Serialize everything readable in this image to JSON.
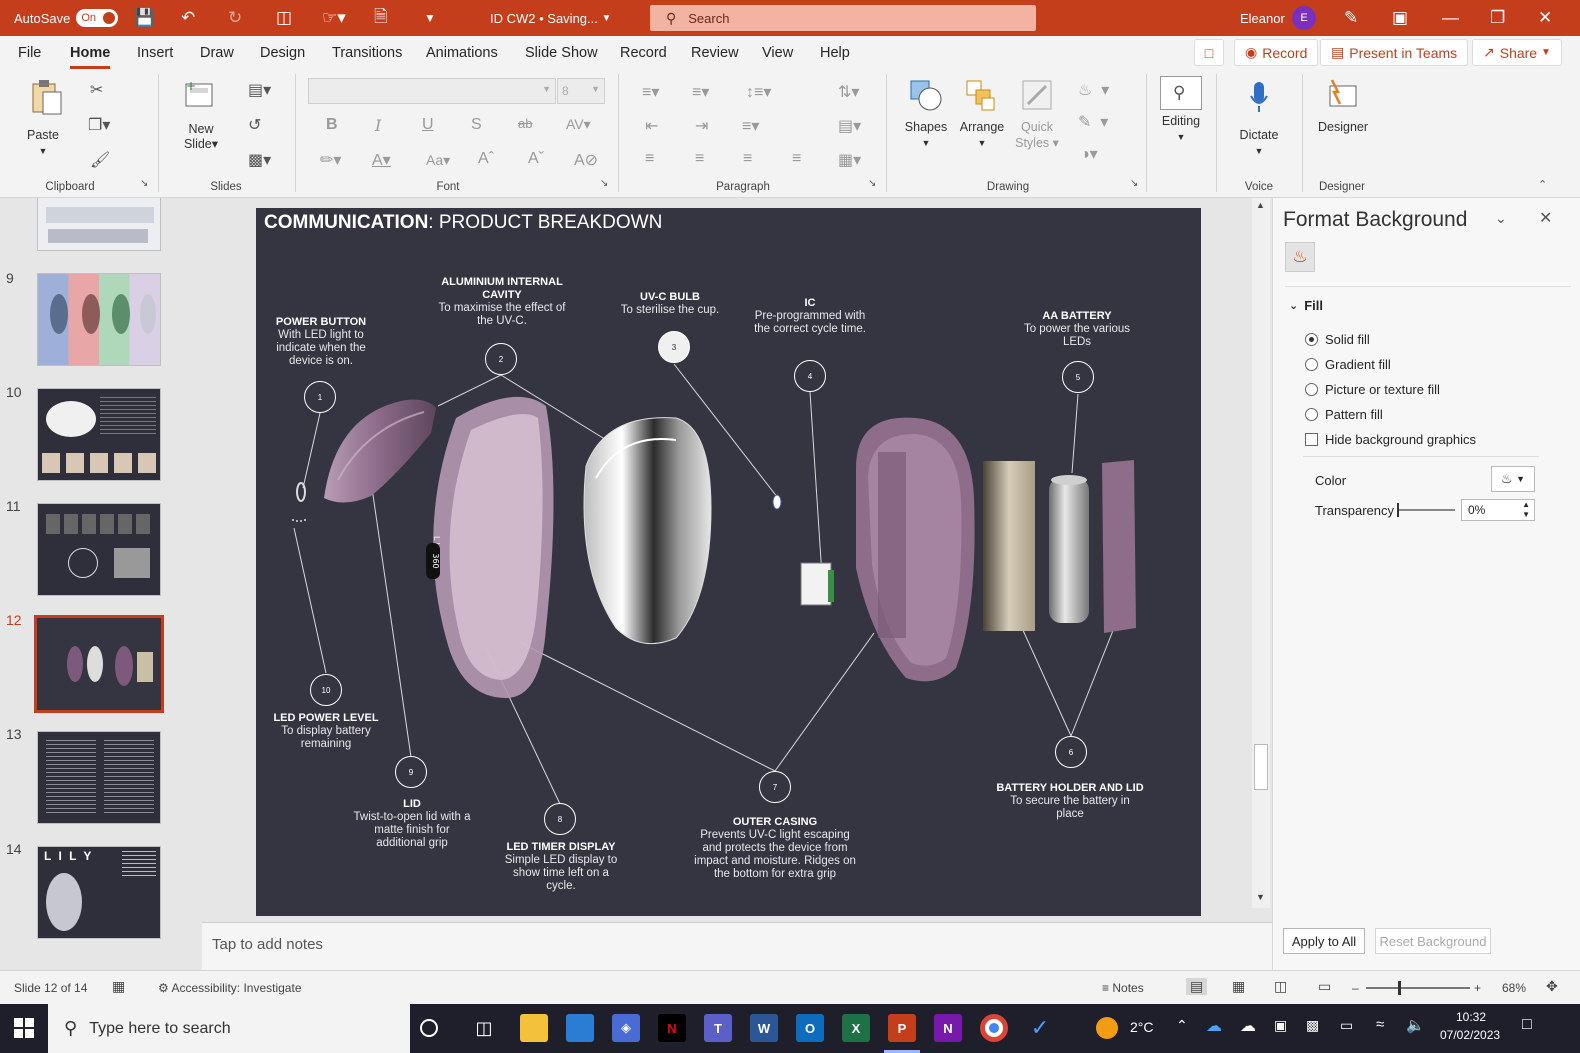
{
  "titlebar": {
    "autosave_label": "AutoSave",
    "autosave_state": "On",
    "doc_title": "ID CW2 • Saving...",
    "search_placeholder": "Search",
    "user_name": "Eleanor",
    "user_initial": "E"
  },
  "tabs": [
    "File",
    "Home",
    "Insert",
    "Draw",
    "Design",
    "Transitions",
    "Animations",
    "Slide Show",
    "Record",
    "Review",
    "View",
    "Help"
  ],
  "active_tab": "Home",
  "ribbon_actions": {
    "record": "Record",
    "present_in_teams": "Present in Teams",
    "share": "Share"
  },
  "ribbon": {
    "paste": "Paste",
    "new_slide_1": "New",
    "new_slide_2": "Slide",
    "font_size": "8",
    "shapes": "Shapes",
    "arrange": "Arrange",
    "quick_styles_1": "Quick",
    "quick_styles_2": "Styles",
    "editing": "Editing",
    "dictate": "Dictate",
    "designer": "Designer",
    "groups": {
      "clipboard": "Clipboard",
      "slides": "Slides",
      "font": "Font",
      "paragraph": "Paragraph",
      "drawing": "Drawing",
      "voice": "Voice",
      "designer": "Designer"
    }
  },
  "thumbnails": {
    "numbers": [
      "9",
      "10",
      "11",
      "12",
      "13",
      "14"
    ],
    "selected": "12",
    "slide14_title": "L I L Y"
  },
  "slide": {
    "title_bold": "COMMUNICATION",
    "title_rest": ": PRODUCT BREAKDOWN",
    "product_name": "LILY",
    "timer_display": "360",
    "labels": [
      {
        "num": "1",
        "title": "POWER BUTTON",
        "desc": "With LED light to indicate when the device is on."
      },
      {
        "num": "2",
        "title": "ALUMINIUM INTERNAL CAVITY",
        "desc": "To maximise the effect of the UV-C."
      },
      {
        "num": "3",
        "title": "UV-C BULB",
        "desc": "To sterilise the cup."
      },
      {
        "num": "4",
        "title": "IC",
        "desc": "Pre-programmed with the correct cycle time."
      },
      {
        "num": "5",
        "title": "AA BATTERY",
        "desc": "To power the various LEDs"
      },
      {
        "num": "6",
        "title": "BATTERY HOLDER AND LID",
        "desc": "To secure the battery in place"
      },
      {
        "num": "7",
        "title": "OUTER CASING",
        "desc": "Prevents UV-C light escaping and protects the device from impact and moisture. Ridges on the bottom for extra grip"
      },
      {
        "num": "8",
        "title": "LED TIMER DISPLAY",
        "desc": "Simple LED display to show time left on a cycle."
      },
      {
        "num": "9",
        "title": "LID",
        "desc": "Twist-to-open lid with a matte finish for additional grip"
      },
      {
        "num": "10",
        "title": "LED POWER LEVEL",
        "desc": "To display battery remaining"
      }
    ]
  },
  "notes_placeholder": "Tap to add notes",
  "format_pane": {
    "title": "Format Background",
    "section": "Fill",
    "options": [
      "Solid fill",
      "Gradient fill",
      "Picture or texture fill",
      "Pattern fill"
    ],
    "selected_option": "Solid fill",
    "hide_graphics": "Hide background graphics",
    "color_label": "Color",
    "transparency_label": "Transparency",
    "transparency_value": "0%",
    "apply_all": "Apply to All",
    "reset": "Reset Background"
  },
  "statusbar": {
    "slide_info": "Slide 12 of 14",
    "accessibility": "Accessibility: Investigate",
    "notes": "Notes",
    "zoom": "68%"
  },
  "taskbar": {
    "search_placeholder": "Type here to search",
    "weather": "2°C",
    "time": "10:32",
    "date": "07/02/2023"
  },
  "colors": {
    "accent": "#c43e1c",
    "slide_bg": "#343541",
    "device_purple": "#7d5a7c"
  }
}
